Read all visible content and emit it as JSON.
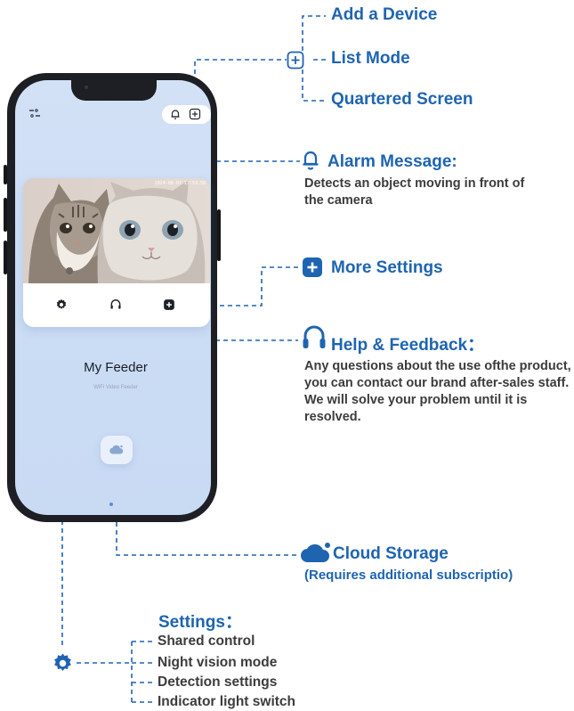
{
  "phone": {
    "timestamp": "2024-08-07 17:53:58",
    "device_name": "My Feeder",
    "device_subtitle": "WiFi Video Feeder"
  },
  "annotations": {
    "add_device": "Add a Device",
    "list_mode": "List Mode",
    "quartered_screen": "Quartered Screen",
    "alarm_title": "Alarm Message:",
    "alarm_desc": "Detects an object moving in front of the camera",
    "more_settings": "More Settings",
    "help_title": "Help & Feedback：",
    "help_desc": "Any questions about the use ofthe product, you can contact our brand after-sales staff. We will solve your problem until it is resolved.",
    "cloud_title": "Cloud Storage",
    "cloud_note": "(Requires additional subscriptio)",
    "settings_title": "Settings：",
    "settings_items": [
      "Shared control",
      "Night vision mode",
      "Detection settings",
      "Indicator light switch"
    ]
  },
  "colors": {
    "accent": "#1f64b1",
    "text": "#3c3c3c",
    "screen_bg": "#cfdff5"
  },
  "icons": [
    "menu-icon",
    "bell-icon",
    "plus-square-icon",
    "gear-icon",
    "headset-icon",
    "cloud-icon"
  ]
}
